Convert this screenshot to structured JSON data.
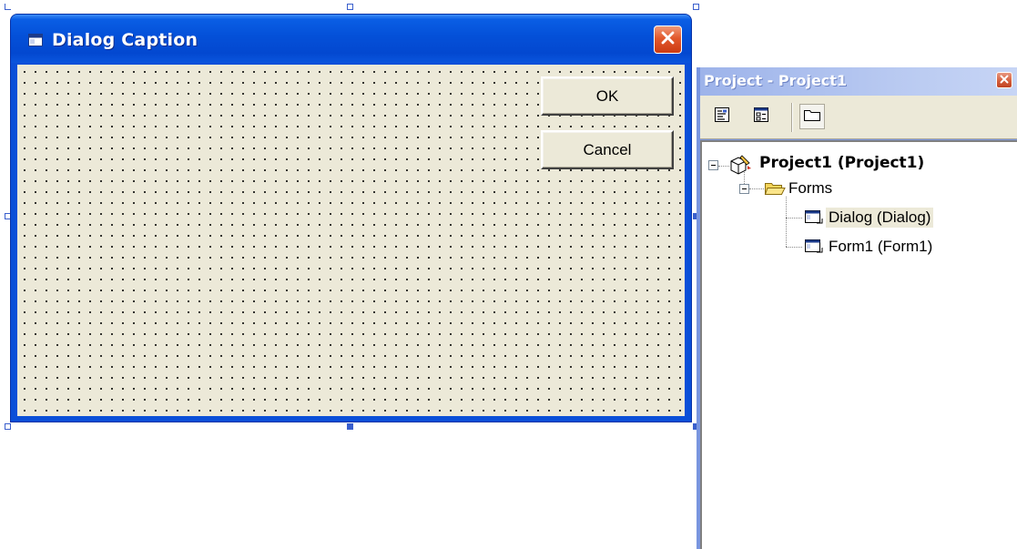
{
  "dialog": {
    "title": "Dialog Caption",
    "buttons": {
      "ok": "OK",
      "cancel": "Cancel"
    }
  },
  "project_explorer": {
    "title": "Project - Project1",
    "toolbar": [
      {
        "icon": "view-code-icon"
      },
      {
        "icon": "view-object-icon"
      },
      {
        "icon": "toggle-folders-icon"
      }
    ],
    "tree": {
      "root": "Project1 (Project1)",
      "folder": "Forms",
      "items": [
        {
          "label": "Dialog (Dialog)",
          "selected": true
        },
        {
          "label": "Form1 (Form1)",
          "selected": false
        }
      ]
    }
  },
  "colors": {
    "xp_title_blue": "#0450d8",
    "face": "#ece9d8",
    "close_red": "#e2582c"
  }
}
